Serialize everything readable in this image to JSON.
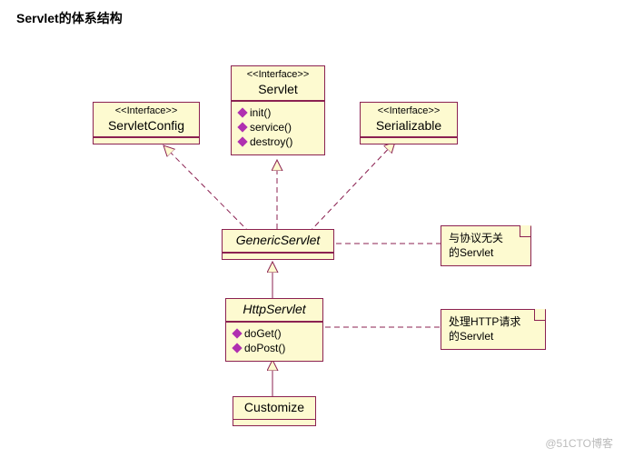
{
  "title": "Servlet的体系结构",
  "watermark": "@51CTO博客",
  "boxes": {
    "servlet": {
      "stereotype": "<<Interface>>",
      "name": "Servlet",
      "ops": [
        "init()",
        "service()",
        "destroy()"
      ]
    },
    "config": {
      "stereotype": "<<Interface>>",
      "name": "ServletConfig"
    },
    "serial": {
      "stereotype": "<<Interface>>",
      "name": "Serializable"
    },
    "generic": {
      "name": "GenericServlet"
    },
    "http": {
      "name": "HttpServlet",
      "ops": [
        "doGet()",
        "doPost()"
      ]
    },
    "custom": {
      "name": "Customize"
    }
  },
  "notes": {
    "n1": {
      "l1": "与协议无关",
      "l2": "的Servlet"
    },
    "n2": {
      "l1": "处理HTTP请求",
      "l2": "的Servlet"
    }
  }
}
